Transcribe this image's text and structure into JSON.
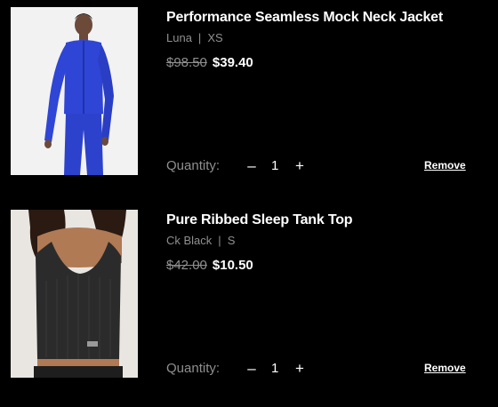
{
  "cart": {
    "items": [
      {
        "title": "Performance Seamless Mock Neck Jacket",
        "color": "Luna",
        "separator": "|",
        "size": "XS",
        "original_price": "$98.50",
        "sale_price": "$39.40",
        "quantity_label": "Quantity:",
        "quantity": "1",
        "minus_symbol": "–",
        "plus_symbol": "+",
        "remove_label": "Remove",
        "image_color": "#2f45d6"
      },
      {
        "title": "Pure Ribbed Sleep Tank Top",
        "color": "Ck Black",
        "separator": "|",
        "size": "S",
        "original_price": "$42.00",
        "sale_price": "$10.50",
        "quantity_label": "Quantity:",
        "quantity": "1",
        "minus_symbol": "–",
        "plus_symbol": "+",
        "remove_label": "Remove",
        "image_color": "#2b2b2b"
      }
    ]
  },
  "colors": {
    "background": "#000000",
    "text_primary": "#ffffff",
    "text_secondary": "#8f8f8f"
  }
}
